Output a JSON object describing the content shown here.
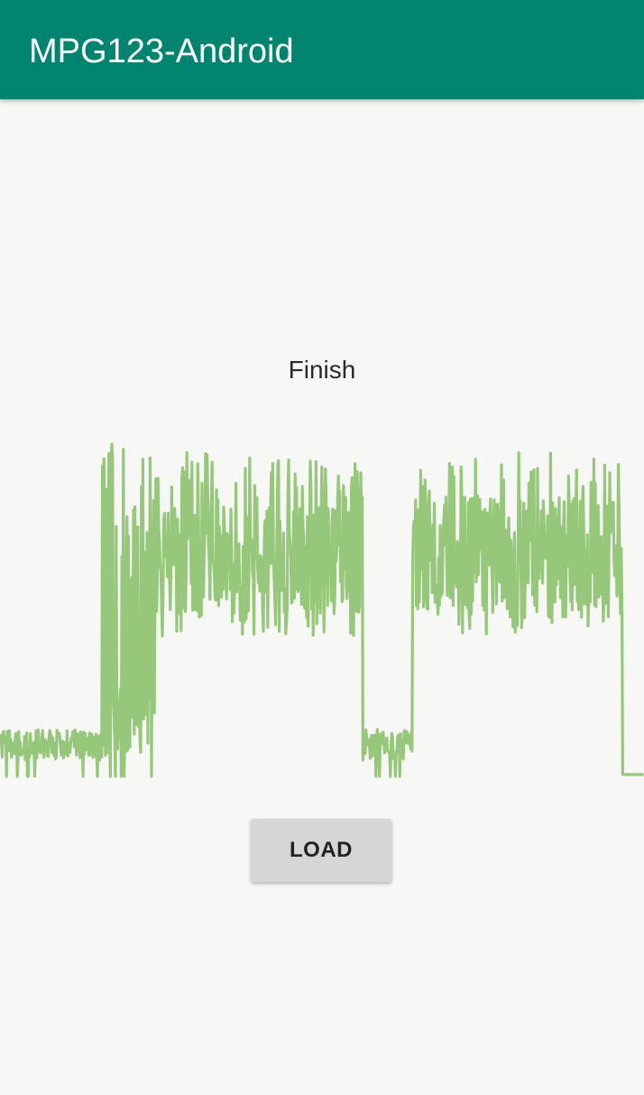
{
  "app_bar": {
    "title": "MPG123-Android",
    "color": "#00846f"
  },
  "status": {
    "text": "Finish"
  },
  "waveform": {
    "color": "#97c77a",
    "segments": [
      {
        "kind": "quiet",
        "start": 0.0,
        "end": 0.158
      },
      {
        "kind": "transition",
        "start": 0.158,
        "end": 0.24
      },
      {
        "kind": "loud",
        "start": 0.24,
        "end": 0.563
      },
      {
        "kind": "quiet",
        "start": 0.563,
        "end": 0.64
      },
      {
        "kind": "loud",
        "start": 0.64,
        "end": 0.966
      },
      {
        "kind": "silence",
        "start": 0.966,
        "end": 1.0
      }
    ]
  },
  "controls": {
    "load_label": "LOAD"
  }
}
